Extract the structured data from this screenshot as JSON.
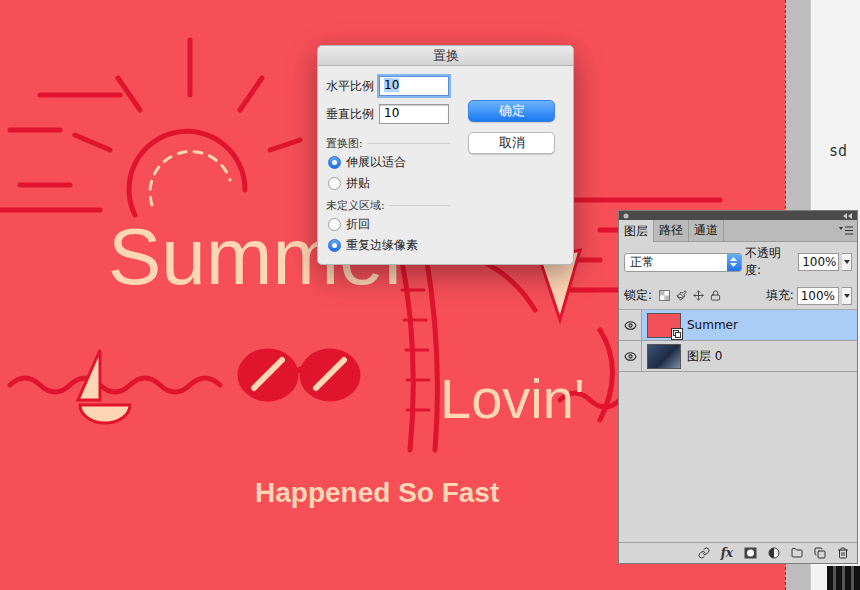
{
  "dialog": {
    "title": "置换",
    "fields": [
      {
        "label": "水平比例",
        "value": "10",
        "focused": true
      },
      {
        "label": "垂直比例",
        "value": "10",
        "focused": false
      }
    ],
    "groups": [
      {
        "title": "置换图:",
        "options": [
          {
            "label": "伸展以适合",
            "selected": true
          },
          {
            "label": "拼贴",
            "selected": false
          }
        ]
      },
      {
        "title": "未定义区域:",
        "options": [
          {
            "label": "折回",
            "selected": false
          },
          {
            "label": "重复边缘像素",
            "selected": true
          }
        ]
      }
    ],
    "buttons": [
      {
        "label": "确定",
        "default": true
      },
      {
        "label": "取消",
        "default": false
      }
    ]
  },
  "layers_panel": {
    "tabs": [
      {
        "label": "图层",
        "selected": true
      },
      {
        "label": "路径",
        "selected": false
      },
      {
        "label": "通道",
        "selected": false
      }
    ],
    "blend_mode": "正常",
    "opacity_label": "不透明度:",
    "opacity": "100%",
    "lock_label": "锁定:",
    "fill_label": "填充:",
    "fill": "100%",
    "layers": [
      {
        "name": "Summer",
        "selected": true,
        "visible": true,
        "kind": "smart",
        "color": "#f2505a"
      },
      {
        "name": "图层 0",
        "selected": false,
        "visible": true,
        "kind": "photo",
        "color": "#3b5377"
      }
    ],
    "fx_label": "fx"
  },
  "canvas": {
    "texts": [
      "Summer",
      "Lovin'",
      "Happened So Fast"
    ]
  },
  "side_text": "sd"
}
